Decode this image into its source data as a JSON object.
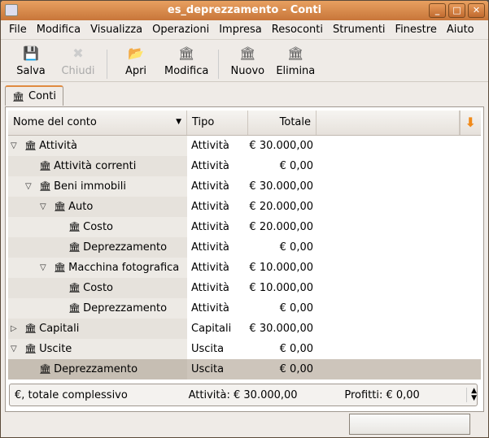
{
  "window": {
    "title": "es_deprezzamento - Conti",
    "buttons": [
      "minimize",
      "maximize",
      "close"
    ]
  },
  "menu": [
    "File",
    "Modifica",
    "Visualizza",
    "Operazioni",
    "Impresa",
    "Resoconti",
    "Strumenti",
    "Finestre",
    "Aiuto"
  ],
  "toolbar": [
    {
      "label": "Salva",
      "icon": "floppy-icon",
      "enabled": true
    },
    {
      "label": "Chiudi",
      "icon": "close-icon",
      "enabled": false
    },
    {
      "label": "Apri",
      "icon": "folder-open-icon",
      "enabled": true
    },
    {
      "label": "Modifica",
      "icon": "edit-account-icon",
      "enabled": true
    },
    {
      "label": "Nuovo",
      "icon": "new-account-icon",
      "enabled": true
    },
    {
      "label": "Elimina",
      "icon": "delete-account-icon",
      "enabled": true
    }
  ],
  "tab": {
    "label": "Conti"
  },
  "columns": {
    "name": "Nome del conto",
    "type": "Tipo",
    "total": "Totale"
  },
  "rows": [
    {
      "name": "Attività",
      "type": "Attività",
      "total": "€ 30.000,00",
      "level": 0,
      "expander": "open"
    },
    {
      "name": "Attività correnti",
      "type": "Attività",
      "total": "€ 0,00",
      "level": 1,
      "expander": ""
    },
    {
      "name": "Beni immobili",
      "type": "Attività",
      "total": "€ 30.000,00",
      "level": 1,
      "expander": "open"
    },
    {
      "name": "Auto",
      "type": "Attività",
      "total": "€ 20.000,00",
      "level": 2,
      "expander": "open"
    },
    {
      "name": "Costo",
      "type": "Attività",
      "total": "€ 20.000,00",
      "level": 3,
      "expander": ""
    },
    {
      "name": "Deprezzamento",
      "type": "Attività",
      "total": "€ 0,00",
      "level": 3,
      "expander": ""
    },
    {
      "name": "Macchina fotografica",
      "type": "Attività",
      "total": "€ 10.000,00",
      "level": 2,
      "expander": "open"
    },
    {
      "name": "Costo",
      "type": "Attività",
      "total": "€ 10.000,00",
      "level": 3,
      "expander": ""
    },
    {
      "name": "Deprezzamento",
      "type": "Attività",
      "total": "€ 0,00",
      "level": 3,
      "expander": ""
    },
    {
      "name": "Capitali",
      "type": "Capitali",
      "total": "€ 30.000,00",
      "level": 0,
      "expander": "closed"
    },
    {
      "name": "Uscite",
      "type": "Uscita",
      "total": "€ 0,00",
      "level": 0,
      "expander": "open"
    },
    {
      "name": "Deprezzamento",
      "type": "Uscita",
      "total": "€ 0,00",
      "level": 1,
      "expander": "",
      "selected": true
    }
  ],
  "summary": {
    "currency": "€, totale complessivo",
    "assets": "Attività: € 30.000,00",
    "profits": "Profitti: € 0,00"
  },
  "colors": {
    "titlebar": "#d8864a",
    "selected_row": "#cdc5bb",
    "accent": "#e08a40"
  }
}
